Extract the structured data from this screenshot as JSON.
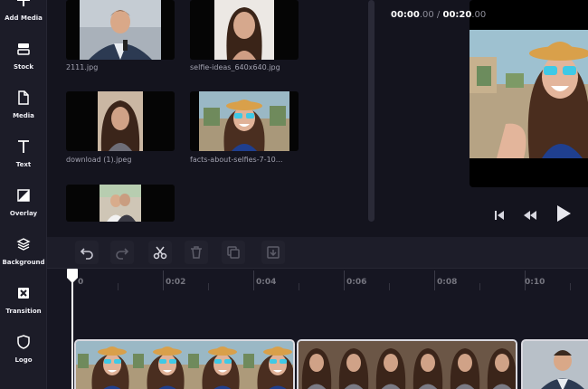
{
  "sidebar": {
    "items": [
      {
        "label": "Add Media",
        "icon": "plus-icon"
      },
      {
        "label": "Stock",
        "icon": "stock-icon"
      },
      {
        "label": "Media",
        "icon": "file-icon"
      },
      {
        "label": "Text",
        "icon": "text-icon"
      },
      {
        "label": "Overlay",
        "icon": "overlay-icon"
      },
      {
        "label": "Background",
        "icon": "layers-icon"
      },
      {
        "label": "Transition",
        "icon": "transition-icon"
      },
      {
        "label": "Logo",
        "icon": "shield-icon"
      }
    ]
  },
  "media": {
    "items": [
      {
        "caption": "2111.jpg"
      },
      {
        "caption": "selfie-ideas_640x640.jpg"
      },
      {
        "caption": "download (1).jpeg"
      },
      {
        "caption": "facts-about-selfies-7-10..."
      },
      {
        "caption": ""
      }
    ]
  },
  "toolbar": {
    "undo_icon": "undo-icon",
    "redo_icon": "redo-icon",
    "split_icon": "scissors-icon",
    "delete_icon": "trash-icon",
    "duplicate_icon": "duplicate-icon",
    "detach_icon": "detach-icon",
    "time_current_main": "00:00",
    "time_current_frac": ".00",
    "time_separator": " / ",
    "time_total_main": "00:20",
    "time_total_frac": ".00"
  },
  "ruler": {
    "labels": [
      "0",
      "0:02",
      "0:04",
      "0:06",
      "0:08",
      "0:10"
    ]
  },
  "player": {
    "prev_icon": "skip-back-icon",
    "rewind_icon": "rewind-icon",
    "play_icon": "play-icon"
  },
  "colors": {
    "background": "#161622",
    "sidebar": "#1c1c28",
    "toolbar": "#1d1d29",
    "playhead": "#ffffff",
    "sunglasses": "#3fc9e6",
    "hat": "#d9a04a"
  }
}
